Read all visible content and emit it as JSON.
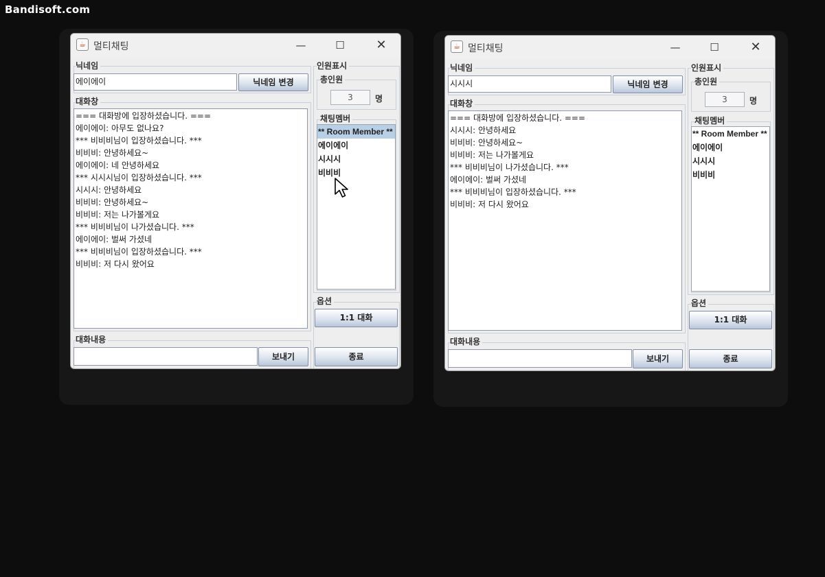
{
  "watermark": "Bandisoft.com",
  "colors": {
    "background": "#0d0d0d",
    "window": "#eeeeee",
    "selection": "#b8cfe5",
    "button_gradient_bottom": "#b9c6da"
  },
  "icons": [
    "java-app-icon",
    "minimize-icon",
    "maximize-icon",
    "close-icon",
    "mouse-pointer-icon"
  ],
  "windows": [
    {
      "title": "멀티채팅",
      "nickname_legend": "닉네임",
      "nickname_value": "에이에이",
      "nickname_button": "닉네임 변경",
      "chat_legend": "대화창",
      "chat_lines": [
        "=== 대화방에 입장하셨습니다. ===",
        "에이에이: 아무도 없나요?",
        "*** 비비비님이 입장하셨습니다. ***",
        "비비비: 안녕하세요~",
        "에이에이: 네 안녕하세요",
        "*** 시시시님이 입장하셨습니다. ***",
        "시시시: 안녕하세요",
        "비비비: 안녕하세요~",
        "비비비: 저는 나가볼게요",
        "*** 비비비님이 나가셨습니다. ***",
        "에이에이: 벌써 가셨네",
        "*** 비비비님이 입장하셨습니다. ***",
        "비비비: 저 다시 왔어요"
      ],
      "message_legend": "대화내용",
      "message_value": "",
      "send_button": "보내기",
      "people_legend": "인원표시",
      "total_legend": "총인원",
      "total_count": "3",
      "total_unit": "명",
      "members_legend": "채팅멤버",
      "members": [
        "** Room Member **",
        "에이에이",
        "시시시",
        "비비비"
      ],
      "selected_member": "** Room Member **",
      "options_legend": "옵션",
      "private_chat_button": "1:1 대화",
      "exit_button": "종료"
    },
    {
      "title": "멀티채팅",
      "nickname_legend": "닉네임",
      "nickname_value": "시시시",
      "nickname_button": "닉네임 변경",
      "chat_legend": "대화창",
      "chat_lines": [
        "=== 대화방에 입장하셨습니다. ===",
        "시시시: 안녕하세요",
        "비비비: 안녕하세요~",
        "비비비: 저는 나가볼게요",
        "*** 비비비님이 나가셨습니다. ***",
        "에이에이: 벌써 가셨네",
        "*** 비비비님이 입장하셨습니다. ***",
        "비비비: 저 다시 왔어요"
      ],
      "message_legend": "대화내용",
      "message_value": "",
      "send_button": "보내기",
      "people_legend": "인원표시",
      "total_legend": "총인원",
      "total_count": "3",
      "total_unit": "명",
      "members_legend": "채팅멤버",
      "members": [
        "** Room Member **",
        "에이에이",
        "시시시",
        "비비비"
      ],
      "selected_member": "",
      "options_legend": "옵션",
      "private_chat_button": "1:1 대화",
      "exit_button": "종료"
    }
  ]
}
